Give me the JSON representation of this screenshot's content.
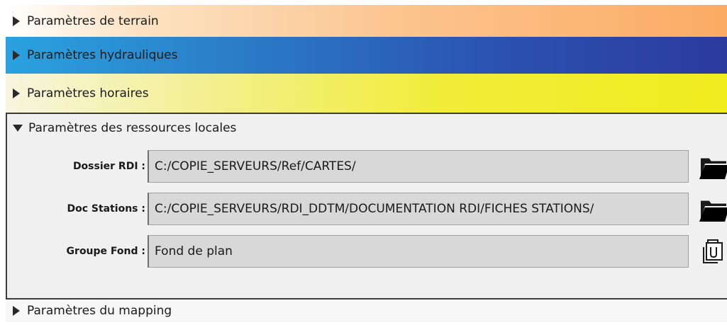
{
  "sections": {
    "terrain": {
      "label": "Paramètres de terrain",
      "arrow_icon": "triangle-right-icon",
      "color": "#fbab63"
    },
    "hydraulique": {
      "label": "Paramètres hydrauliques",
      "arrow_icon": "triangle-right-icon",
      "color": "#2b55b3"
    },
    "horaires": {
      "label": "Paramètres horaires",
      "arrow_icon": "triangle-right-icon",
      "color": "#f0ec1e"
    },
    "ressources_locales": {
      "label": "Paramètres des ressources locales",
      "arrow_icon": "triangle-down-icon",
      "fields": [
        {
          "label": "Dossier RDI :",
          "value": "C:/COPIE_SERVEURS/Ref/CARTES/",
          "button_icon": "folder-icon"
        },
        {
          "label": "Doc Stations :",
          "value": "C:/COPIE_SERVEURS/RDI_DDTM/DOCUMENTATION RDI/FICHES STATIONS/",
          "button_icon": "folder-icon"
        },
        {
          "label": "Groupe Fond :",
          "value": "Fond de plan",
          "button_icon": "layers-copy-icon"
        }
      ]
    },
    "mapping": {
      "label": "Paramètres du mapping",
      "arrow_icon": "triangle-right-icon"
    }
  }
}
